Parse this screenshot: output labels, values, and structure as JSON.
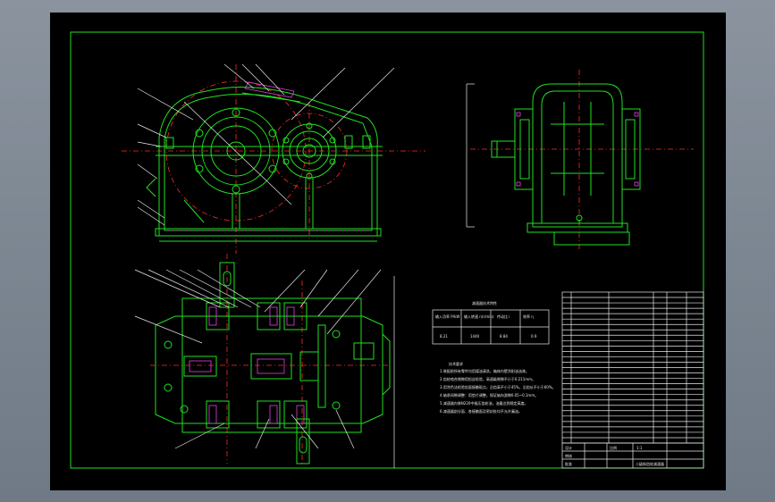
{
  "drawing": {
    "title_block": {
      "drawing_name": "二级斜齿轮减速器",
      "label_design": "设计",
      "label_check": "审核",
      "label_approve": "批准",
      "label_scale": "比例",
      "scale_value": "1:1"
    },
    "param_table": {
      "title": "减速器技术特性",
      "headers": [
        "输入功率 P/kW",
        "输入转速 n(r/min)",
        "传动比 i",
        "效率 η"
      ],
      "values": [
        "8.21",
        "1440",
        "8.84",
        "0.9"
      ]
    },
    "tech_req": {
      "title": "技术要求",
      "lines": [
        "1.装配前所有零件均用煤油清洗，箱体内壁涂耐油油漆。",
        "2.齿轮啮合侧隙用铅丝检验，高速级侧隙不小于0.211mm。",
        "3.用涂色法检验齿面接触斑点，沿齿高不小于45%，沿齿长不小于60%。",
        "4.轴承间隙调整：用垫片调整，保证轴向游隙0.05~0.1mm。",
        "5.减速器内装N220中极压齿轮油，油量达到规定高度。",
        "6.减速器剖分面、各接触面及密封处均不允许漏油。"
      ]
    },
    "parts_list": {
      "rows": 28
    }
  }
}
